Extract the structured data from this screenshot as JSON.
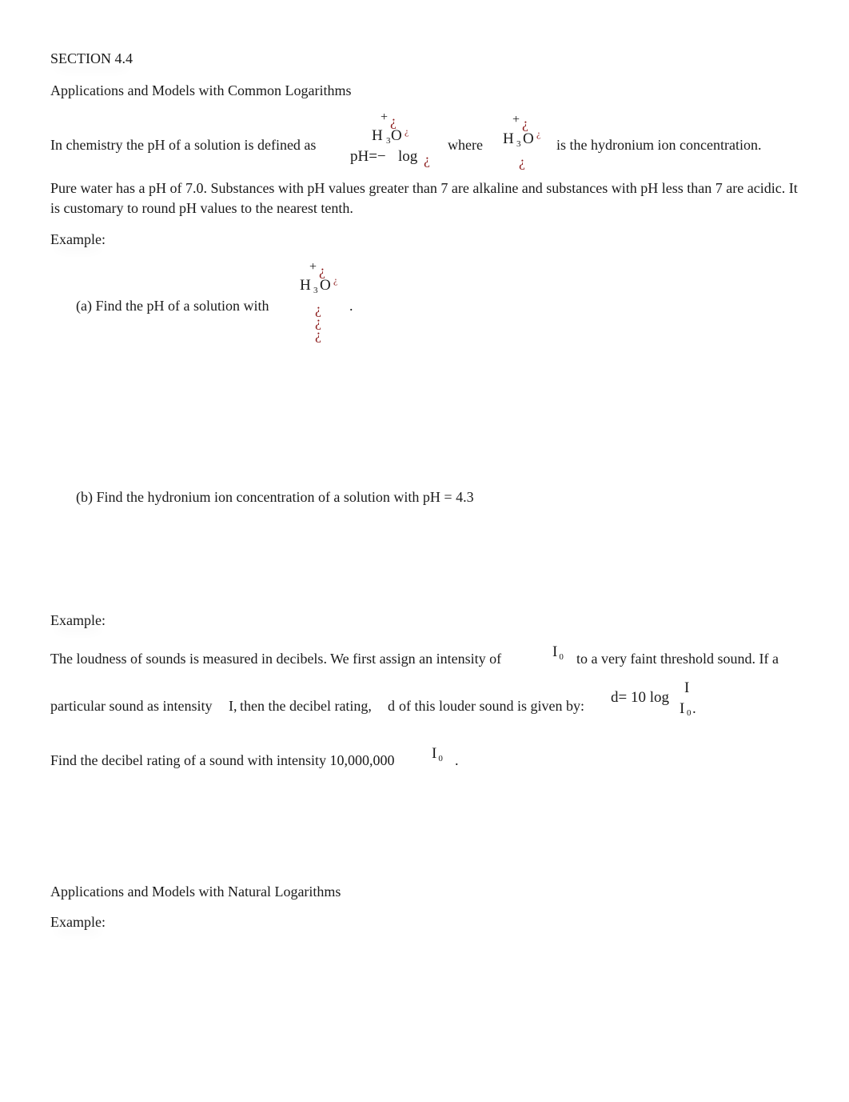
{
  "section": {
    "title": "SECTION 4.4",
    "heading_common": "Applications and Models with Common Logarithms",
    "heading_natural": "Applications and Models with Natural Logarithms"
  },
  "ph_definition": {
    "intro": "In chemistry the pH of a solution is defined as",
    "formula": {
      "plus": "+",
      "broken_glyph": "¿",
      "h": "H",
      "three": "3",
      "o": "O",
      "lhs": "pH=−",
      "log": "log"
    },
    "where": "where",
    "suffix": "is the hydronium ion concentration."
  },
  "ph_paragraph": "Pure water has a pH of 7.0.  Substances with pH values greater than 7 are alkaline and substances with pH less than 7 are acidic. It is customary to round pH values to the nearest tenth.",
  "example_label": "Example:",
  "example1": {
    "part_a": "(a)  Find the pH of a solution with",
    "part_a_end": ".",
    "part_b": "(b)  Find the hydronium ion concentration of a solution with pH  = 4.3"
  },
  "example2": {
    "line1_a": "The loudness of sounds is measured in decibels.  We first assign an intensity of",
    "line1_b": "to a very faint threshold sound.   If a",
    "line2_a": "particular sound as intensity",
    "line2_I": "I,",
    "line2_b": "then the decibel rating,",
    "line2_d": "d",
    "line2_c": "of this louder sound is given by:",
    "formula_lhs": "d= 10 log",
    "formula_num": "I",
    "formula_den": "I",
    "formula_den_sub": "0",
    "formula_end": ".",
    "i0_main": "I",
    "i0_sub": "0",
    "question": "Find the decibel rating of a sound with intensity 10,000,000",
    "question_end": "."
  }
}
